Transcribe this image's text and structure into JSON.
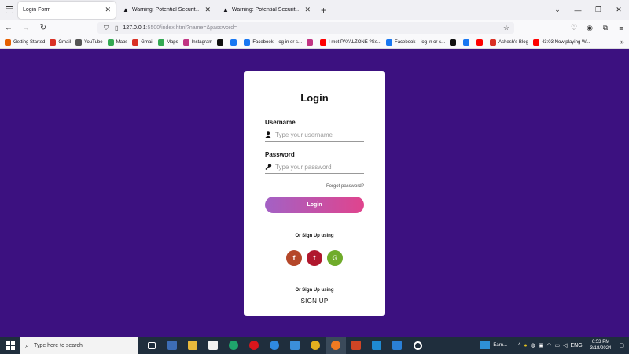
{
  "browser": {
    "tabs": [
      {
        "title": "Login Form",
        "active": true
      },
      {
        "title": "Warning: Potential Security Risk Ahead",
        "active": false
      },
      {
        "title": "Warning: Potential Security Risk Ahead",
        "active": false
      }
    ],
    "url_host": "127.0.0.1",
    "url_path": ":5500/index.html?name=&password=",
    "bookmarks": [
      {
        "label": "Getting Started",
        "color": "#e66000"
      },
      {
        "label": "Gmail",
        "color": "#d93025"
      },
      {
        "label": "YouTube",
        "color": "#555555"
      },
      {
        "label": "Maps",
        "color": "#34a853"
      },
      {
        "label": "Gmail",
        "color": "#d93025"
      },
      {
        "label": "Maps",
        "color": "#34a853"
      },
      {
        "label": "Instagram",
        "color": "#c13584"
      },
      {
        "label": "",
        "color": "#111111"
      },
      {
        "label": "",
        "color": "#1877f2"
      },
      {
        "label": "Facebook - log in or s...",
        "color": "#1877f2"
      },
      {
        "label": "",
        "color": "#c13584"
      },
      {
        "label": "I met PAYALZONE ?Se...",
        "color": "#ff0000"
      },
      {
        "label": "Facebook – log in or s...",
        "color": "#1877f2"
      },
      {
        "label": "",
        "color": "#111111"
      },
      {
        "label": "",
        "color": "#1877f2"
      },
      {
        "label": "",
        "color": "#ff0000"
      },
      {
        "label": "Ashesh's Blog",
        "color": "#d93025"
      },
      {
        "label": "43:03 Now playing W...",
        "color": "#ff0000"
      }
    ]
  },
  "form": {
    "title": "Login",
    "username_label": "Username",
    "username_placeholder": "Type your username",
    "password_label": "Password",
    "password_placeholder": "Type your password",
    "forgot": "Forgot password?",
    "login_button": "Login",
    "or_signup_1": "Or Sign Up using",
    "socials": [
      {
        "letter": "f",
        "name": "facebook",
        "color": "#b5472a"
      },
      {
        "letter": "t",
        "name": "twitter",
        "color": "#b0172d"
      },
      {
        "letter": "G",
        "name": "google",
        "color": "#6fab2a"
      }
    ],
    "or_signup_2": "Or Sign Up using",
    "signup": "SIGN UP"
  },
  "colors": {
    "page_bg": "#3c1180",
    "button_gradient_start": "#a361c5",
    "button_gradient_end": "#e0448d"
  },
  "taskbar": {
    "search_placeholder": "Type here to search",
    "weather": "Earn...",
    "lang": "ENG",
    "time": "6:53 PM",
    "date": "3/18/2024"
  }
}
